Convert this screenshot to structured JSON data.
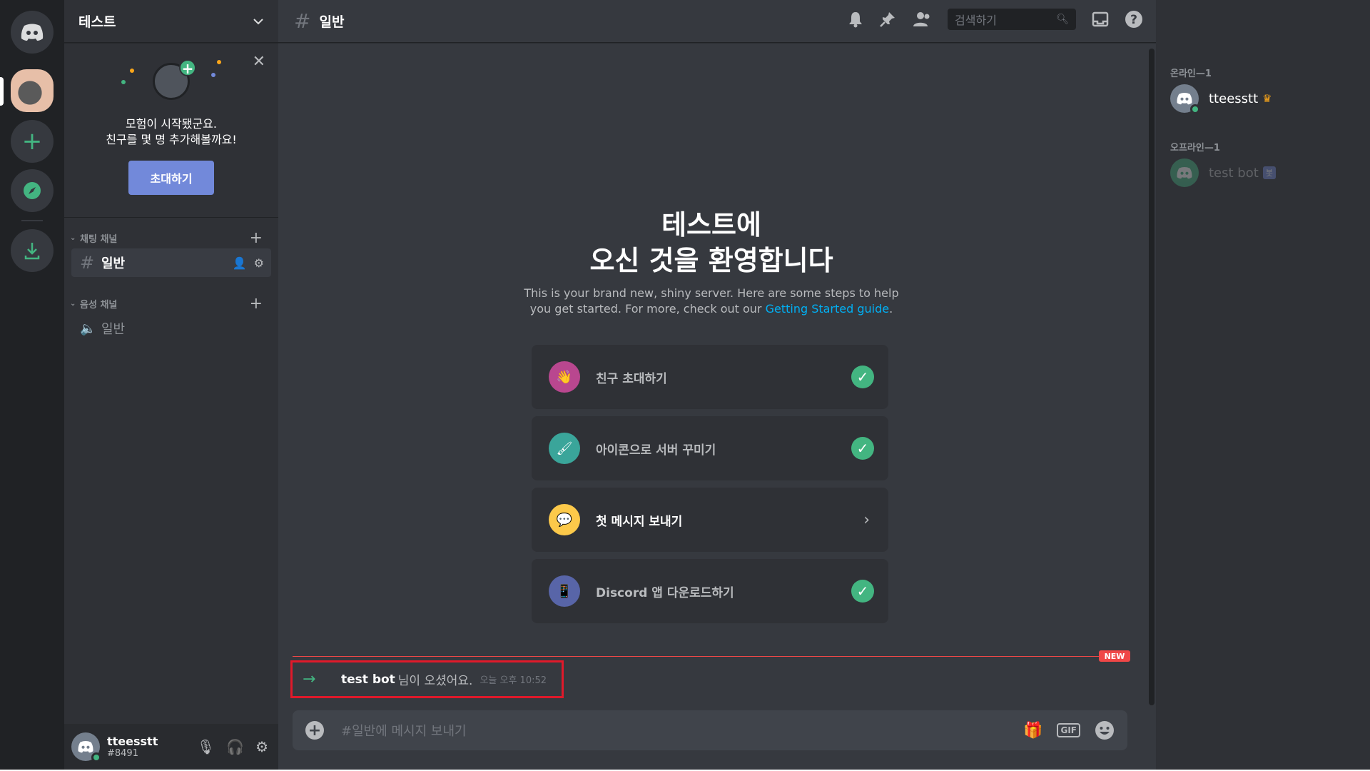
{
  "server_name": "테스트",
  "invite_card": {
    "line1": "모험이 시작됐군요.",
    "line2": "친구를 몇 명 추가해볼까요!",
    "button": "초대하기"
  },
  "categories": [
    {
      "label": "채팅 채널",
      "channels": [
        {
          "name": "일반"
        }
      ]
    },
    {
      "label": "음성 채널",
      "channels": [
        {
          "name": "일반"
        }
      ]
    }
  ],
  "user": {
    "name": "tteesstt",
    "tag": "#8491"
  },
  "channel": {
    "name": "일반"
  },
  "search": {
    "placeholder": "검색하기"
  },
  "welcome": {
    "line1": "테스트에",
    "line2": "오신 것을 환영합니다",
    "desc1": "This is your brand new, shiny server. Here are some steps to help",
    "desc2_prefix": "you get started. For more, check out our ",
    "desc2_link": "Getting Started guide",
    "desc2_suffix": "."
  },
  "tasks": [
    {
      "label": "친구 초대하기",
      "state": "done",
      "icon": "invite-icon",
      "color": "#b9478f"
    },
    {
      "label": "아이콘으로 서버 꾸미기",
      "state": "done",
      "icon": "brush-icon",
      "color": "#3aa59a"
    },
    {
      "label": "첫 메시지 보내기",
      "state": "todo",
      "icon": "message-icon",
      "color": "#fcc94a"
    },
    {
      "label": "Discord 앱 다운로드하기",
      "state": "done",
      "icon": "phone-icon",
      "color": "#5865a8"
    }
  ],
  "new_badge": "NEW",
  "system_message": {
    "user": "test bot",
    "text": "님이 오셨어요.",
    "timestamp": "오늘 오후 10:52"
  },
  "composer": {
    "placeholder": "#일반에 메시지 보내기",
    "gif": "GIF"
  },
  "members": {
    "online_header": "온라인—1",
    "online": [
      {
        "name": "tteesstt",
        "owner": true
      }
    ],
    "offline_header": "오프라인—1",
    "offline": [
      {
        "name": "test bot",
        "badge": "봇"
      }
    ]
  },
  "colors": {
    "accent": "#7289da",
    "online": "#43b581",
    "danger": "#f04747",
    "link": "#00b0f4"
  }
}
